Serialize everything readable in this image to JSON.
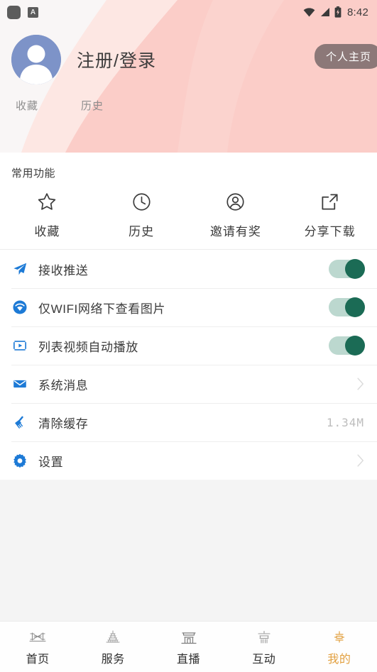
{
  "statusbar": {
    "time": "8:42",
    "icons": [
      "app-square-icon",
      "letter-a-icon",
      "wifi-icon",
      "signal-icon",
      "battery-icon"
    ]
  },
  "header": {
    "avatar": "default-user-avatar",
    "login_label": "注册/登录",
    "home_badge_label": "个人主页",
    "mini_tabs": [
      {
        "label": "收藏",
        "name": "favorites"
      },
      {
        "label": "历史",
        "name": "history"
      }
    ],
    "colors": {
      "band_dark": "#fbcdc8",
      "band_light": "#fde7e3",
      "band_pale": "#f8f6f6",
      "badge_bg": "#8c7878",
      "avatar_bg": "#7d93c8"
    }
  },
  "common": {
    "section_title": "常用功能",
    "items": [
      {
        "label": "收藏",
        "icon": "star-icon"
      },
      {
        "label": "历史",
        "icon": "clock-icon"
      },
      {
        "label": "邀请有奖",
        "icon": "user-circle-icon"
      },
      {
        "label": "分享下载",
        "icon": "share-external-icon"
      }
    ]
  },
  "settings": {
    "rows": [
      {
        "label": "接收推送",
        "icon": "paper-plane-icon",
        "control": "toggle",
        "value": "on"
      },
      {
        "label": "仅WIFI网络下查看图片",
        "icon": "wifi-circle-icon",
        "control": "toggle",
        "value": "on"
      },
      {
        "label": "列表视频自动播放",
        "icon": "video-film-icon",
        "control": "toggle",
        "value": "on"
      },
      {
        "label": "系统消息",
        "icon": "envelope-icon",
        "control": "chevron",
        "value": ""
      },
      {
        "label": "清除缓存",
        "icon": "broom-icon",
        "control": "value",
        "value": "1.34M"
      },
      {
        "label": "设置",
        "icon": "gear-icon",
        "control": "chevron",
        "value": ""
      }
    ],
    "colors": {
      "icon_blue": "#1d7ad6",
      "toggle_track": "#bcd8cf",
      "toggle_knob": "#1b6b55"
    }
  },
  "bottom_nav": {
    "active_index": 4,
    "active_color": "#e2a040",
    "items": [
      {
        "label": "首页",
        "icon": "bridge-icon"
      },
      {
        "label": "服务",
        "icon": "pagoda-icon"
      },
      {
        "label": "直播",
        "icon": "gate-house-icon"
      },
      {
        "label": "互动",
        "icon": "pavilion-icon"
      },
      {
        "label": "我的",
        "icon": "lantern-icon"
      }
    ]
  }
}
